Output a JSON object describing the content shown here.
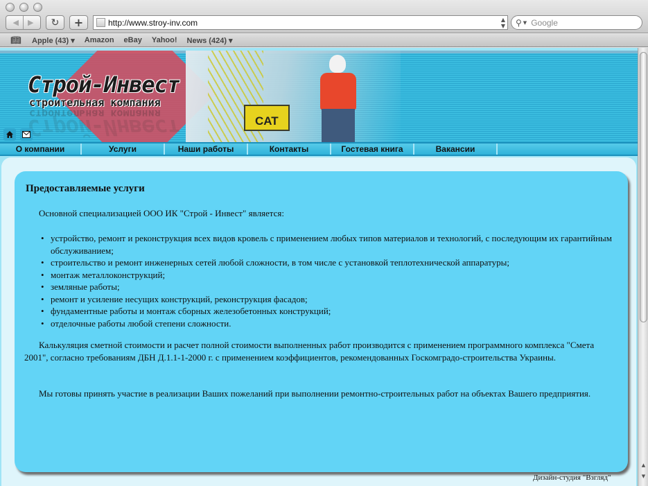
{
  "browser": {
    "url": "http://www.stroy-inv.com",
    "search_placeholder": "Google",
    "bookmarks": [
      "Apple (43) ▾",
      "Amazon",
      "eBay",
      "Yahoo!",
      "News (424) ▾"
    ]
  },
  "header": {
    "logo_title": "Строй-Инвест",
    "logo_subtitle": "строительная компания",
    "machine_label": "CAT"
  },
  "menu": [
    "О компании",
    "Услуги",
    "Наши работы",
    "Контакты",
    "Гостевая книга",
    "Вакансии"
  ],
  "content": {
    "heading": "Предоставляемые услуги",
    "intro": "Основной специализацией ООО ИК \"Строй - Инвест\" является:",
    "services": [
      "устройство, ремонт и реконструкция всех видов кровель с применением любых типов материалов и технологий, с последующим их гарантийным обслуживанием;",
      "строительство и ремонт инженерных сетей любой сложности, в том числе с установкой теплотехнической аппаратуры;",
      "монтаж металлоконструкций;",
      "земляные работы;",
      "ремонт и усиление несущих конструкций, реконструкция фасадов;",
      "фундаментные работы и монтаж сборных железобетонных конструкций;",
      "отделочные работы любой степени сложности."
    ],
    "paragraph_calc": "Калькуляция сметной стоимости и расчет полной стоимости выполненных работ производится с применением программного комплекса \"Смета 2001\", согласно требованиям ДБН Д.1.1-1-2000 г. с применением коэффициентов, рекомендованных Госкомградо-строительства Украины.",
    "paragraph_ready": "Мы готовы принять участие в реализации Ваших пожеланий при выполнении ремонтно-строительных работ на объектах Вашего предприятия."
  },
  "footer": {
    "credit": "Дизайн-студия \"Взгляд\""
  },
  "colors": {
    "banner": "#3bbde0",
    "panel": "#62d4f6",
    "page_background": "#9fe4f5",
    "accent_red": "#d8495a"
  }
}
